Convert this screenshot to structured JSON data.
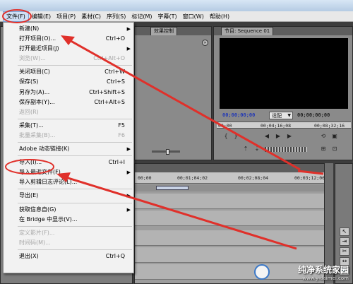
{
  "menubar": {
    "items": [
      {
        "label": "文件(F)",
        "active": true
      },
      {
        "label": "编辑(E)"
      },
      {
        "label": "项目(P)"
      },
      {
        "label": "素材(C)"
      },
      {
        "label": "序列(S)"
      },
      {
        "label": "标记(M)"
      },
      {
        "label": "字幕(T)"
      },
      {
        "label": "窗口(W)"
      },
      {
        "label": "帮助(H)"
      }
    ]
  },
  "file_menu": {
    "items": [
      {
        "label": "新建(N)",
        "shortcut": "",
        "submenu": true,
        "enabled": true
      },
      {
        "label": "打开项目(O)...",
        "shortcut": "Ctrl+O",
        "submenu": false,
        "enabled": true
      },
      {
        "label": "打开最近项目(J)",
        "shortcut": "",
        "submenu": true,
        "enabled": true
      },
      {
        "label": "浏览(W)...",
        "shortcut": "Ctrl+Alt+O",
        "submenu": false,
        "enabled": false
      },
      {
        "sep": true
      },
      {
        "label": "关闭项目(C)",
        "shortcut": "Ctrl+W",
        "submenu": false,
        "enabled": true
      },
      {
        "label": "保存(S)",
        "shortcut": "Ctrl+S",
        "submenu": false,
        "enabled": true
      },
      {
        "label": "另存为(A)...",
        "shortcut": "Ctrl+Shift+S",
        "submenu": false,
        "enabled": true
      },
      {
        "label": "保存副本(Y)...",
        "shortcut": "Ctrl+Alt+S",
        "submenu": false,
        "enabled": true
      },
      {
        "label": "返回(R)",
        "shortcut": "",
        "submenu": false,
        "enabled": false
      },
      {
        "sep": true
      },
      {
        "label": "采集(T)...",
        "shortcut": "F5",
        "submenu": false,
        "enabled": true
      },
      {
        "label": "批量采集(B)...",
        "shortcut": "F6",
        "submenu": false,
        "enabled": false
      },
      {
        "sep": true
      },
      {
        "label": "Adobe 动态链接(K)",
        "shortcut": "",
        "submenu": true,
        "enabled": true
      },
      {
        "sep": true
      },
      {
        "label": "导入(I)...",
        "shortcut": "Ctrl+I",
        "submenu": false,
        "enabled": true,
        "highlight": true
      },
      {
        "label": "导入最近文件(F)",
        "shortcut": "",
        "submenu": true,
        "enabled": true
      },
      {
        "label": "导入剪辑日志评论(L)...",
        "shortcut": "",
        "submenu": false,
        "enabled": true
      },
      {
        "sep": true
      },
      {
        "label": "导出(E)",
        "shortcut": "",
        "submenu": true,
        "enabled": true
      },
      {
        "sep": true
      },
      {
        "label": "获取信息自(G)",
        "shortcut": "",
        "submenu": true,
        "enabled": true
      },
      {
        "label": "在 Bridge 中显示(V)...",
        "shortcut": "",
        "submenu": false,
        "enabled": true
      },
      {
        "sep": true
      },
      {
        "label": "定义影片(F)...",
        "shortcut": "",
        "submenu": false,
        "enabled": false
      },
      {
        "label": "时间码(M)...",
        "shortcut": "",
        "submenu": false,
        "enabled": false
      },
      {
        "sep": true
      },
      {
        "label": "退出(X)",
        "shortcut": "Ctrl+Q",
        "submenu": false,
        "enabled": true
      }
    ]
  },
  "effects_panel": {
    "tab_label": "效果控制"
  },
  "program_monitor": {
    "tab_label": "节目: Sequence 01",
    "current_timecode": "00;00;00;00",
    "fit_select": "适配",
    "duration": "00;00;00;00",
    "ruler_marks": [
      "00;00",
      "00;04;16;08",
      "00;08;32;16"
    ]
  },
  "timeline": {
    "time_marks": [
      "00;00",
      "00;01;04;02",
      "00;02;08;04",
      "00;03;12;06"
    ]
  },
  "watermark": {
    "title": "纯净系统家园",
    "url": "www.yidaimei.com"
  },
  "colors": {
    "annotation": "#e0302a",
    "menu_bg": "#f2f2f2",
    "timecode": "#2339b5"
  }
}
